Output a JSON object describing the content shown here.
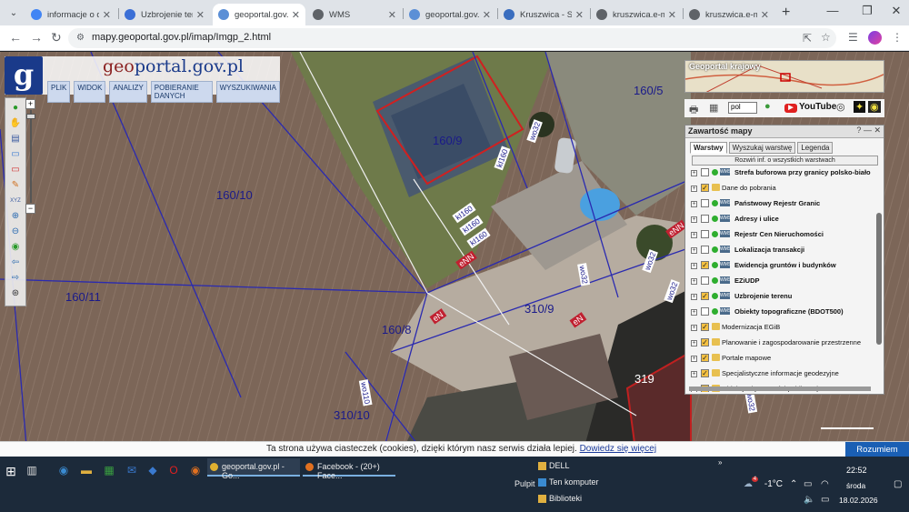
{
  "browser": {
    "tabs": [
      {
        "label": "informacje o dział",
        "color": "#4285f4"
      },
      {
        "label": "Uzbrojenie teren",
        "color": "#3b6fd6"
      },
      {
        "label": "geoportal.gov.pl",
        "color": "#5b8fd6"
      },
      {
        "label": "WMS",
        "color": "#5f6368"
      },
      {
        "label": "geoportal.gov.pl",
        "color": "#5b8fd6"
      },
      {
        "label": "Kruszwica - Syste",
        "color": "#3a6ebf"
      },
      {
        "label": "kruszwica.e-map",
        "color": "#5f6368"
      },
      {
        "label": "kruszwica.e-map",
        "color": "#5f6368"
      }
    ],
    "active_tab_index": 2,
    "url": "mapy.geoportal.gov.pl/imap/Imgp_2.html"
  },
  "geoportal": {
    "logo": "g",
    "title_part1": "geo",
    "title_part2": "portal.gov.pl",
    "menu": [
      "PLIK",
      "WIDOK",
      "ANALIZY",
      "POBIERANIE DANYCH",
      "WYSZUKIWANIA"
    ],
    "minimap_title": "Geoportal krajowy",
    "language": "pol",
    "youtube": "YouTube"
  },
  "map_labels": {
    "parcels": [
      "160/5",
      "160/9",
      "160/10",
      "160/11",
      "160/8",
      "310/9",
      "310/10",
      "319"
    ],
    "roads": [
      "wo32",
      "wo32",
      "wo32",
      "wo32",
      "wo110",
      "wo32"
    ],
    "side_labels": [
      "kI160",
      "kI160",
      "kI160",
      "kI160"
    ],
    "red_labels": [
      "eNN",
      "eN",
      "eN",
      "eNN"
    ]
  },
  "content_panel": {
    "title": "Zawartość mapy",
    "tabs": [
      "Warstwy",
      "Wyszukaj warstwę",
      "Legenda"
    ],
    "expand_button": "Rozwiń inf. o wszystkich warstwach",
    "layers": [
      {
        "name": "Strefa buforowa przy granicy polsko-biało",
        "checked": false,
        "type": "wms",
        "bold": true
      },
      {
        "name": "Dane do pobrania",
        "checked": true,
        "type": "folder",
        "bold": false
      },
      {
        "name": "Państwowy Rejestr Granic",
        "checked": false,
        "type": "wms",
        "bold": true
      },
      {
        "name": "Adresy i ulice",
        "checked": false,
        "type": "wms",
        "bold": true
      },
      {
        "name": "Rejestr Cen Nieruchomości",
        "checked": false,
        "type": "wms",
        "bold": true
      },
      {
        "name": "Lokalizacja transakcji",
        "checked": false,
        "type": "wms",
        "bold": true
      },
      {
        "name": "Ewidencja gruntów i budynków",
        "checked": true,
        "type": "wms",
        "bold": true
      },
      {
        "name": "EZiUDP",
        "checked": false,
        "type": "wms",
        "bold": true
      },
      {
        "name": "Uzbrojenie terenu",
        "checked": true,
        "type": "wms",
        "bold": true
      },
      {
        "name": "Obiekty topograficzne (BDOT500)",
        "checked": false,
        "type": "wms",
        "bold": true
      },
      {
        "name": "Modernizacja EGiB",
        "checked": true,
        "type": "folder",
        "bold": false
      },
      {
        "name": "Planowanie i zagospodarowanie przestrzenne",
        "checked": true,
        "type": "folder",
        "bold": false
      },
      {
        "name": "Portale mapowe",
        "checked": true,
        "type": "folder",
        "bold": false
      },
      {
        "name": "Specjalistyczne informacje geodezyjne",
        "checked": true,
        "type": "folder",
        "bold": false
      },
      {
        "name": "Obiekty użyteczności publicznej",
        "checked": true,
        "type": "folder",
        "bold": false
      }
    ]
  },
  "cookie": {
    "text": "Ta strona używa ciasteczek (cookies), dzięki którym nasz serwis działa lepiej.",
    "link": "Dowiedz się więcej",
    "button": "Rozumiem"
  },
  "taskbar": {
    "tasks": [
      "geoportal.gov.pl - Go...",
      "Facebook - (20+) Face..."
    ],
    "desktop_items": [
      "DELL",
      "Ten komputer",
      "Biblioteki"
    ],
    "pulpit": "Pulpit",
    "weather": "-1°C",
    "time": "22:52",
    "day": "środa",
    "date": "18.02.2026",
    "notification_count": "4"
  },
  "colors": {
    "chrome_tab_bar": "#dfe3e8",
    "taskbar": "#1c2a3a",
    "cookie_button": "#1a5fb4",
    "parcel_line": "#2a2ab0",
    "building_outline": "#d02020"
  }
}
